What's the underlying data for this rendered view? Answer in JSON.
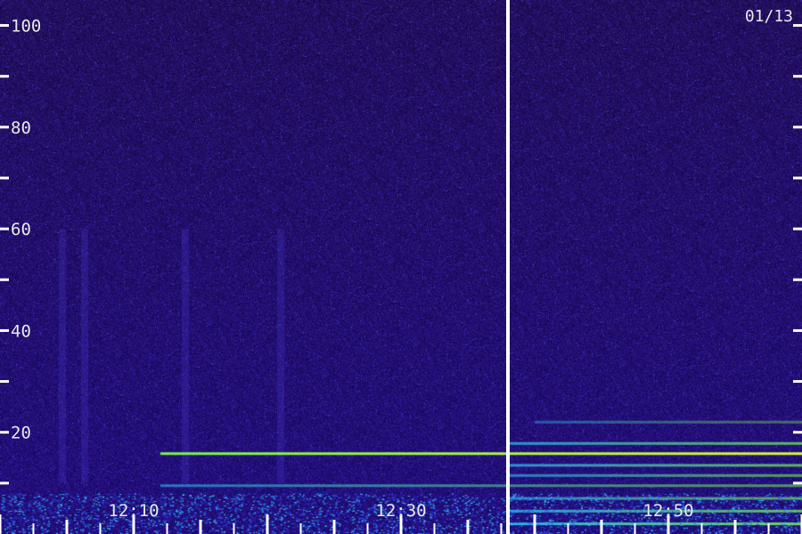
{
  "chart_data": {
    "type": "heatmap",
    "date_label": "01/13",
    "x_tick_labels": [
      "12:10",
      "12:30",
      "12:50"
    ],
    "x_tick_minutes": [
      10,
      30,
      50
    ],
    "x_range_minutes": [
      0,
      60
    ],
    "marker_minute": 38,
    "y_tick_labels": [
      "20",
      "40",
      "60",
      "80",
      "100"
    ],
    "y_tick_values": [
      20,
      40,
      60,
      80,
      100
    ],
    "y_minor_values": [
      10,
      30,
      50,
      70,
      90
    ],
    "y_range": [
      0,
      105
    ],
    "bands": [
      {
        "y": 15.8,
        "start_minute": 12,
        "intensity": 0.95
      },
      {
        "y": 13.5,
        "start_minute": 38,
        "intensity": 0.7
      },
      {
        "y": 11.5,
        "start_minute": 38,
        "intensity": 0.6
      },
      {
        "y": 9.5,
        "start_minute": 12,
        "intensity": 0.55
      },
      {
        "y": 7.0,
        "start_minute": 38,
        "intensity": 0.65
      },
      {
        "y": 4.5,
        "start_minute": 38,
        "intensity": 0.75
      },
      {
        "y": 2.0,
        "start_minute": 38,
        "intensity": 0.85
      },
      {
        "y": 17.8,
        "start_minute": 38,
        "intensity": 0.7
      },
      {
        "y": 22.0,
        "start_minute": 40,
        "intensity": 0.4
      }
    ],
    "colors": {
      "background": "#1a0838",
      "noise_low": "#250a5a",
      "noise_high": "#3a1aa8",
      "band_cyan": "#30c8ff",
      "band_green": "#7cff4c",
      "band_yellow": "#e8ff40",
      "marker": "#ffffff",
      "ticks": "#ffffff"
    }
  }
}
